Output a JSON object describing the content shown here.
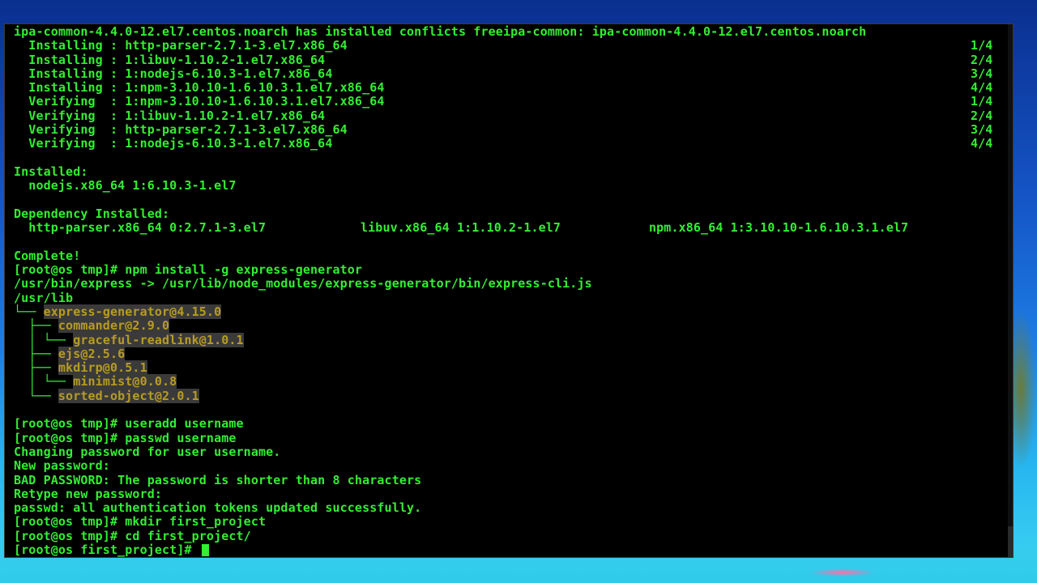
{
  "terminal": {
    "lines": [
      "ipa-common-4.4.0-12.el7.centos.noarch has installed conflicts freeipa-common: ipa-common-4.4.0-12.el7.centos.noarch",
      "  Installing : http-parser-2.7.1-3.el7.x86_64",
      "  Installing : 1:libuv-1.10.2-1.el7.x86_64",
      "  Installing : 1:nodejs-6.10.3-1.el7.x86_64",
      "  Installing : 1:npm-3.10.10-1.6.10.3.1.el7.x86_64",
      "  Verifying  : 1:npm-3.10.10-1.6.10.3.1.el7.x86_64",
      "  Verifying  : 1:libuv-1.10.2-1.el7.x86_64",
      "  Verifying  : http-parser-2.7.1-3.el7.x86_64",
      "  Verifying  : 1:nodejs-6.10.3-1.el7.x86_64",
      "",
      "Installed:",
      "  nodejs.x86_64 1:6.10.3-1.el7",
      "",
      "Dependency Installed:",
      "  http-parser.x86_64 0:2.7.1-3.el7",
      "",
      "Complete!",
      "[root@os tmp]# npm install -g express-generator",
      "/usr/bin/express -> /usr/lib/node_modules/express-generator/bin/express-cli.js",
      "/usr/lib",
      "",
      "",
      "",
      "",
      "",
      "",
      "",
      "",
      "[root@os tmp]# useradd username",
      "[root@os tmp]# passwd username",
      "Changing password for user username.",
      "New password:",
      "BAD PASSWORD: The password is shorter than 8 characters",
      "Retype new password:",
      "passwd: all authentication tokens updated successfully.",
      "[root@os tmp]# mkdir first_project",
      "[root@os tmp]# cd first_project/",
      "[root@os first_project]# "
    ],
    "progress": [
      "",
      "1/4",
      "2/4",
      "3/4",
      "4/4",
      "1/4",
      "2/4",
      "3/4",
      "4/4"
    ],
    "dependency_cols": [
      "libuv.x86_64 1:1.10.2-1.el7",
      "npm.x86_64 1:3.10.10-1.6.10.3.1.el7"
    ],
    "tree": [
      {
        "prefix": "└── ",
        "name": "express-generator@4.15.0"
      },
      {
        "prefix": "  ├── ",
        "name": "commander@2.9.0"
      },
      {
        "prefix": "  │ └── ",
        "name": "graceful-readlink@1.0.1"
      },
      {
        "prefix": "  ├── ",
        "name": "ejs@2.5.6"
      },
      {
        "prefix": "  ├── ",
        "name": "mkdirp@0.5.1"
      },
      {
        "prefix": "  │ └── ",
        "name": "minimist@0.0.8"
      },
      {
        "prefix": "  └── ",
        "name": "sorted-object@2.0.1"
      }
    ]
  },
  "colors": {
    "text": "#33ee33",
    "highlight_bg": "#3a3a3a",
    "highlight_text": "#b89b24",
    "terminal_bg": "#000000"
  }
}
